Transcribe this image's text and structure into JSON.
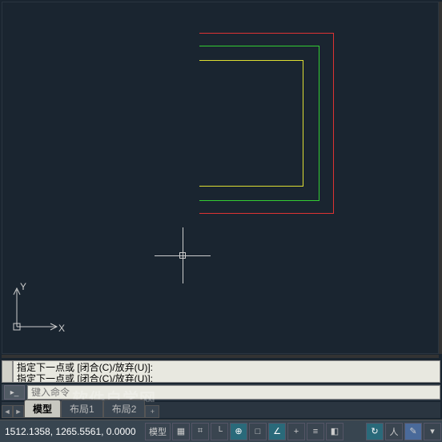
{
  "ucs": {
    "x_label": "X",
    "y_label": "Y"
  },
  "history": {
    "line1": "指定下一点或 [闭合(C)/放弃(U)]:",
    "line2": "指定下一点或 [闭合(C)/放弃(U)]:"
  },
  "command": {
    "icon_label": "▸_",
    "placeholder": "键入命令"
  },
  "tabs": {
    "nav_prev": "◄",
    "nav_next": "►",
    "items": [
      {
        "label": "模型",
        "active": true
      },
      {
        "label": "布局1",
        "active": false
      },
      {
        "label": "布局2",
        "active": false
      }
    ],
    "add": "+"
  },
  "status": {
    "coords": "1512.1358, 1265.5561, 0.0000",
    "model_btn": "模型",
    "icons": [
      {
        "name": "grid-icon",
        "glyph": "▦"
      },
      {
        "name": "snap-icon",
        "glyph": "⌗"
      },
      {
        "name": "ortho-icon",
        "glyph": "└"
      },
      {
        "name": "polar-icon",
        "glyph": "⊕"
      },
      {
        "name": "osnap-icon",
        "glyph": "□"
      },
      {
        "name": "track-icon",
        "glyph": "∠"
      },
      {
        "name": "dyn-icon",
        "glyph": "+"
      },
      {
        "name": "lineweight-icon",
        "glyph": "≡"
      },
      {
        "name": "transparency-icon",
        "glyph": "◧"
      },
      {
        "name": "cycle-icon",
        "glyph": "↻"
      },
      {
        "name": "annotation-icon",
        "glyph": "人"
      },
      {
        "name": "pencil-icon",
        "glyph": "✎"
      },
      {
        "name": "settings-icon",
        "glyph": "▾"
      }
    ]
  },
  "watermark": "软件自学网"
}
